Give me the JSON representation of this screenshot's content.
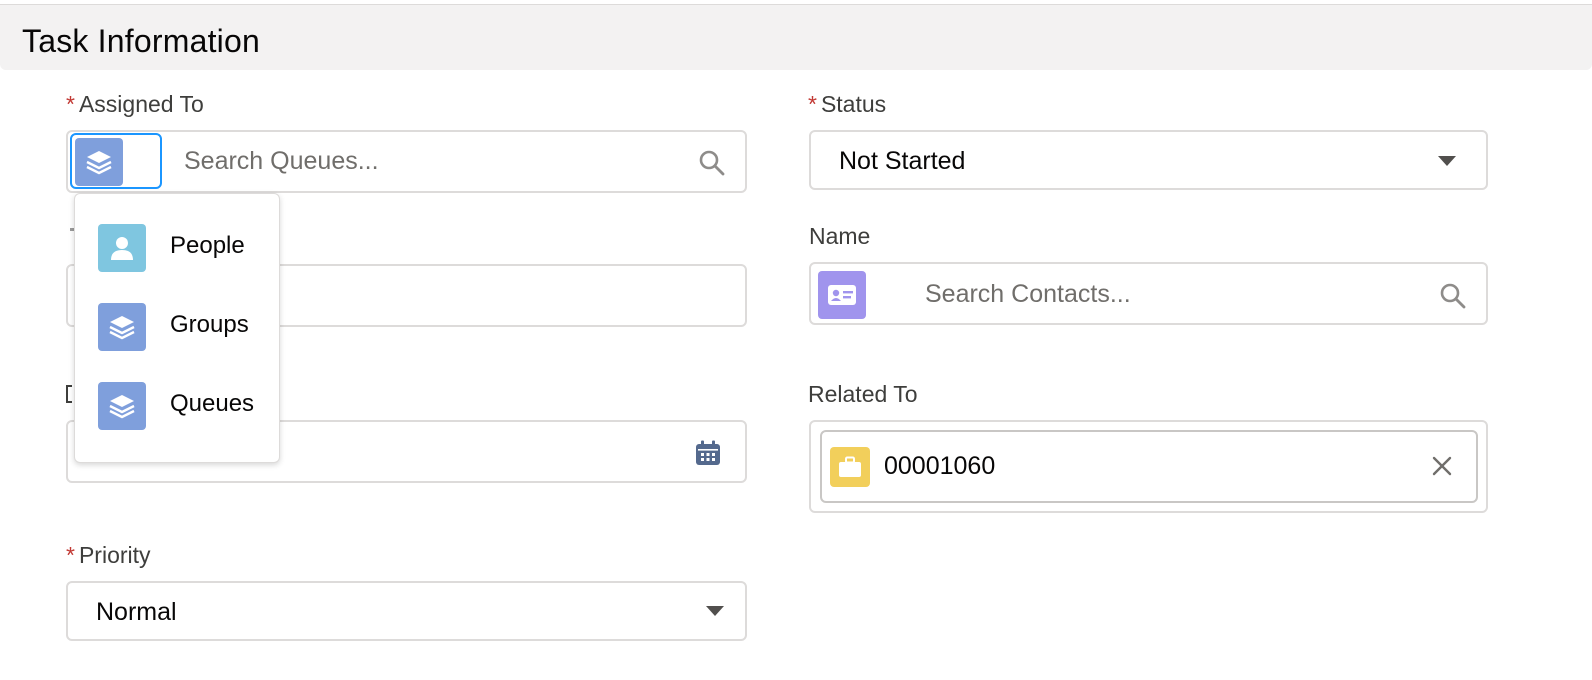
{
  "section": {
    "title": "Task Information"
  },
  "fields": {
    "assigned_to": {
      "required_mark": "*",
      "label": "Assigned To",
      "placeholder": "Search Queues...",
      "scope_icon": "queue-stack-icon",
      "search_icon": "search-icon"
    },
    "status": {
      "required_mark": "*",
      "label": "Status",
      "value": "Not Started"
    },
    "name": {
      "label": "Name",
      "placeholder": "Search Contacts...",
      "icon": "contact-card-icon"
    },
    "related_to": {
      "label": "Related To",
      "value": "00001060",
      "icon": "briefcase-icon",
      "remove_icon": "close-icon"
    },
    "due_date": {
      "icon": "calendar-icon"
    },
    "priority": {
      "required_mark": "*",
      "label": "Priority",
      "value": "Normal"
    }
  },
  "scope_menu": {
    "items": [
      {
        "label": "People",
        "icon": "user-icon"
      },
      {
        "label": "Groups",
        "icon": "groups-stack-icon"
      },
      {
        "label": "Queues",
        "icon": "queues-stack-icon"
      }
    ]
  },
  "colors": {
    "required": "#c23934",
    "queue_icon_bg": "#7f9fdc",
    "people_icon_bg": "#7fc6e0",
    "contact_icon_bg": "#a094ed",
    "case_icon_bg": "#f2cf5b",
    "focus_border": "#1b96ff",
    "header_bg": "#f3f2f2"
  }
}
